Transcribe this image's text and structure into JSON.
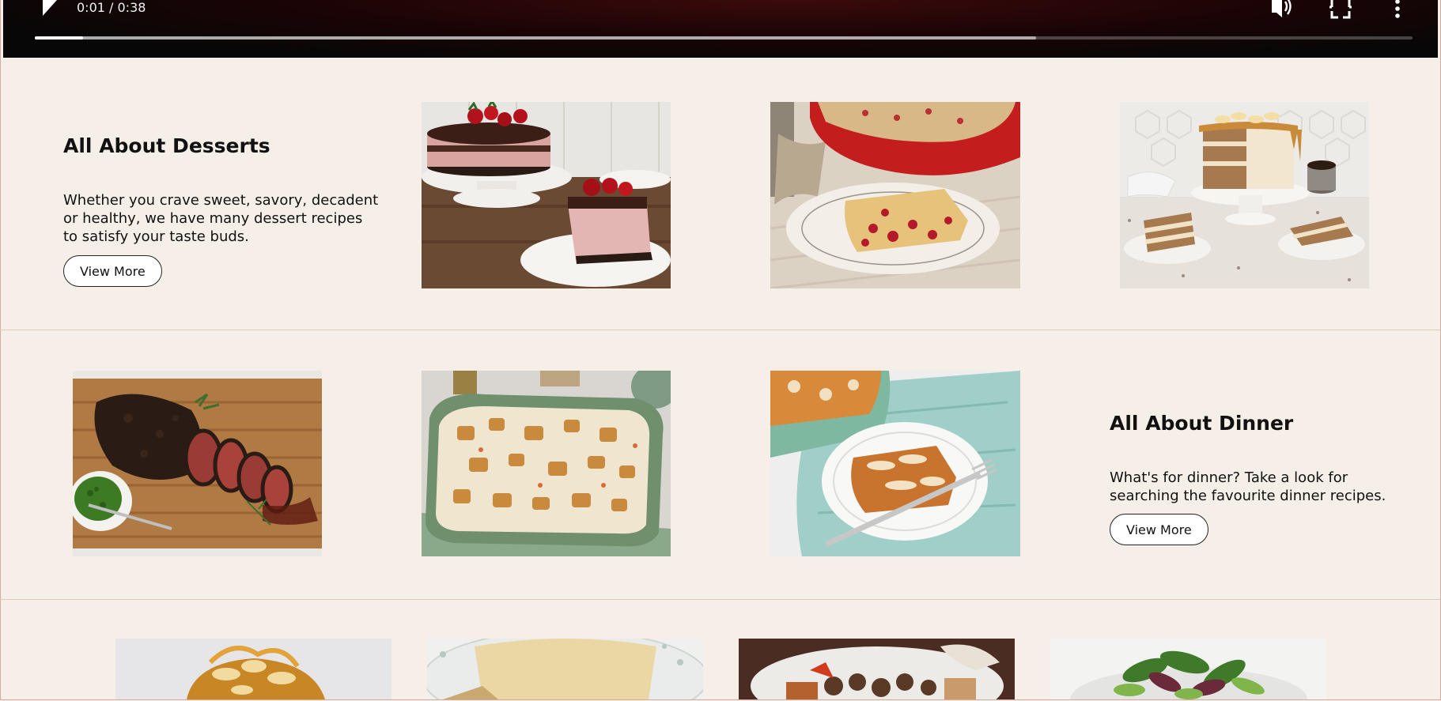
{
  "video": {
    "time_label": "0:01 / 0:38",
    "progress_fraction": 0.035,
    "buffered_fraction": 0.727
  },
  "desserts": {
    "title": "All About Desserts",
    "description": "Whether you crave sweet, savory, decadent or healthy, we have many dessert recipes to satisfy your taste buds.",
    "button_label": "View More"
  },
  "dinner": {
    "title": "All About Dinner",
    "description": "What's for dinner? Take a look for searching the favourite dinner recipes.",
    "button_label": "View More"
  },
  "colors": {
    "page_background": "#f6efe8",
    "divider": "#ddc9bb",
    "button_border": "#222222"
  },
  "icons": [
    "play-icon",
    "volume-icon",
    "fullscreen-icon",
    "more-vert-icon"
  ]
}
